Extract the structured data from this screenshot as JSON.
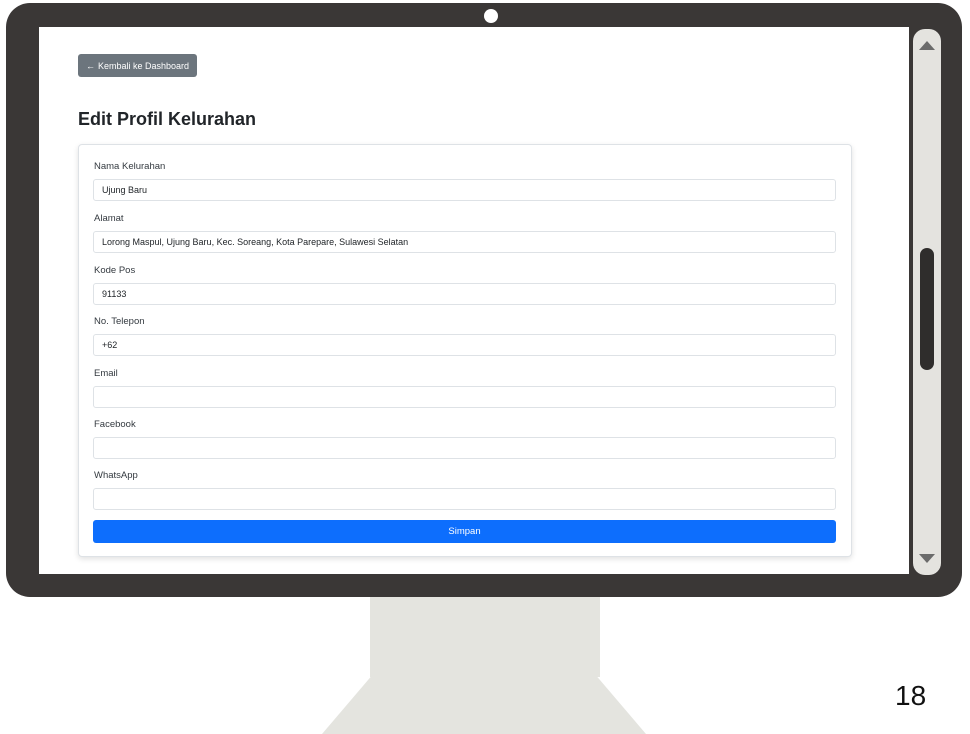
{
  "header": {
    "back_button": "Kembali ke Dashboard",
    "back_arrow": "←",
    "title": "Edit Profil Kelurahan"
  },
  "form": {
    "fields": [
      {
        "label": "Nama Kelurahan",
        "value": "Ujung Baru"
      },
      {
        "label": "Alamat",
        "value": "Lorong Maspul, Ujung Baru, Kec. Soreang, Kota Parepare, Sulawesi Selatan"
      },
      {
        "label": "Kode Pos",
        "value": "91133"
      },
      {
        "label": "No. Telepon",
        "value": "+62"
      },
      {
        "label": "Email",
        "value": ""
      },
      {
        "label": "Facebook",
        "value": ""
      },
      {
        "label": "WhatsApp",
        "value": ""
      }
    ],
    "submit_label": "Simpan"
  },
  "slide": {
    "page_number": "18"
  },
  "colors": {
    "primary": "#0d6efd",
    "secondary": "#6c757d",
    "monitor_frame": "#3a3736"
  }
}
